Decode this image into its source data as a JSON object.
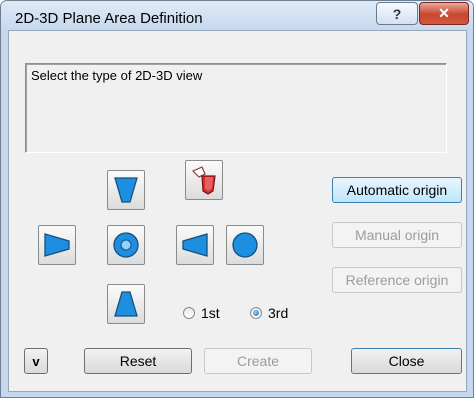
{
  "window": {
    "title": "2D-3D Plane Area Definition"
  },
  "titlebar": {
    "help_label": "?",
    "close_label": "✕"
  },
  "description": {
    "text": "Select the type of 2D-3D view"
  },
  "buttons": {
    "automatic_origin": "Automatic origin",
    "manual_origin": "Manual origin",
    "reference_origin": "Reference origin",
    "v": "v",
    "reset": "Reset",
    "create": "Create",
    "close": "Close"
  },
  "projection": {
    "options": [
      "1st",
      "3rd"
    ],
    "selected": "3rd"
  },
  "view_buttons": [
    "view-top",
    "view-left",
    "view-front",
    "view-right",
    "view-back",
    "view-bottom",
    "view-3d"
  ],
  "colors": {
    "accent": "#3c7fb1",
    "view_fill": "#1e8fe0",
    "titlebar": "#c6d9ef"
  }
}
